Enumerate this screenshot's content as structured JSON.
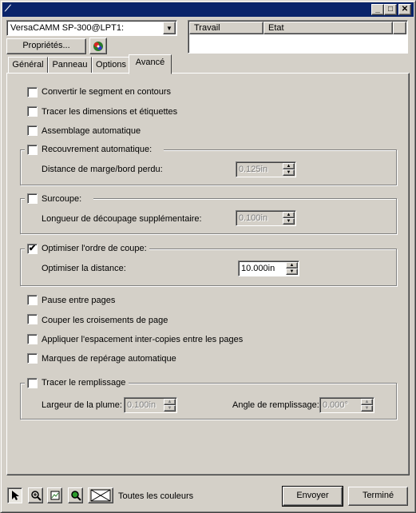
{
  "window": {
    "title_icon": "ruler-icon",
    "minimize": "_",
    "maximize": "□",
    "close": "✕"
  },
  "printer": {
    "selected": "VersaCAMM SP-300@LPT1:",
    "arrow": "▼"
  },
  "properties_label": "Propriétés...",
  "queue": {
    "columns": [
      "Travail",
      "Etat"
    ]
  },
  "tabs": [
    {
      "label": "Général"
    },
    {
      "label": "Panneau"
    },
    {
      "label": "Options"
    },
    {
      "label": "Avancé",
      "active": true
    }
  ],
  "options": {
    "convert_segment": {
      "label": "Convertir le segment en contours",
      "checked": false
    },
    "trace_dimensions": {
      "label": "Tracer les dimensions et étiquettes",
      "checked": false
    },
    "auto_assembly": {
      "label": "Assemblage automatique",
      "checked": false
    },
    "auto_overlap": {
      "label": "Recouvrement automatique:",
      "checked": false,
      "field_label": "Distance de marge/bord perdu:",
      "value": "0.125in"
    },
    "overcut": {
      "label": "Surcoupe:",
      "checked": false,
      "field_label": "Longueur de découpage supplémentaire:",
      "value": "0.100in"
    },
    "optimize_order": {
      "label": "Optimiser l'ordre de coupe:",
      "checked": true,
      "field_label": "Optimiser la distance:",
      "value": "10.000in"
    },
    "pause_pages": {
      "label": "Pause entre pages",
      "checked": false
    },
    "cut_crossings": {
      "label": "Couper les croisements de page",
      "checked": false
    },
    "inter_copy_spacing": {
      "label": "Appliquer l'espacement inter-copies entre les pages",
      "checked": false
    },
    "auto_registration": {
      "label": "Marques de repérage automatique",
      "checked": false
    },
    "fill": {
      "label": "Tracer le remplissage",
      "checked": false,
      "pen_width_label": "Largeur de la plume:",
      "pen_width_value": "0.100in",
      "angle_label": "Angle de remplissage:",
      "angle_value": "0.000°"
    }
  },
  "check_mark": "✔",
  "toolbar": {
    "colors_label": "Toutes les couleurs",
    "tools": [
      "pointer-icon",
      "zoom-in-icon",
      "fit-page-icon",
      "zoom-color-icon",
      "envelope-icon"
    ]
  },
  "send_label": "Envoyer",
  "done_label": "Terminé"
}
